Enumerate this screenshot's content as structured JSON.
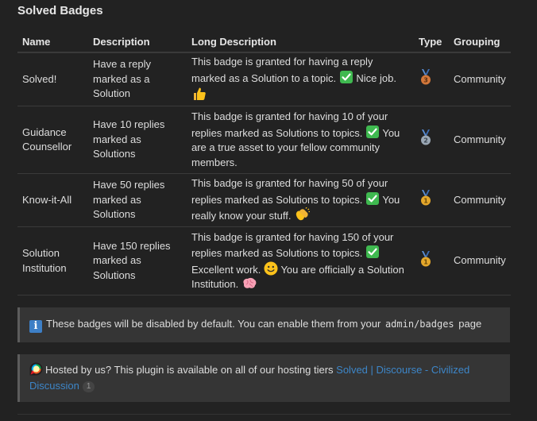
{
  "title": "Solved Badges",
  "columns": [
    "Name",
    "Description",
    "Long Description",
    "Type",
    "Grouping"
  ],
  "rows": [
    {
      "name": "Solved!",
      "description": "Have a reply marked as a Solution",
      "long_parts": [
        "This badge is granted for having a reply marked as a Solution to a topic.",
        "Nice job."
      ],
      "emojis": [
        "check-mark-emoji",
        "thumbs-up-emoji"
      ],
      "type": "bronze",
      "type_number": "3",
      "grouping": "Community"
    },
    {
      "name": "Guidance Counsellor",
      "description": "Have 10 replies marked as Solutions",
      "long_parts": [
        "This badge is granted for having 10 of your replies marked as Solutions to topics.",
        "You are a true asset to your fellow community members."
      ],
      "emojis": [
        "check-mark-emoji"
      ],
      "type": "silver",
      "type_number": "2",
      "grouping": "Community"
    },
    {
      "name": "Know-it-All",
      "description": "Have 50 replies marked as Solutions",
      "long_parts": [
        "This badge is granted for having 50 of your replies marked as Solutions to topics.",
        "You really know your stuff."
      ],
      "emojis": [
        "check-mark-emoji",
        "clapping-hands-emoji"
      ],
      "type": "gold",
      "type_number": "1",
      "grouping": "Community"
    },
    {
      "name": "Solution Institution",
      "description": "Have 150 replies marked as Solutions",
      "long_parts": [
        "This badge is granted for having 150 of your replies marked as Solutions to topics.",
        "Excellent work.",
        "You are officially a Solution Institution."
      ],
      "emojis": [
        "check-mark-emoji",
        "slightly-smiling-emoji",
        "brain-emoji"
      ],
      "type": "gold",
      "type_number": "1",
      "grouping": "Community"
    }
  ],
  "info_callout": {
    "icon": "i",
    "text": "These badges will be disabled by default. You can enable them from your",
    "code": "admin/badges",
    "text_after": "page"
  },
  "hosted_callout": {
    "text": "Hosted by us? This plugin is available on all of our hosting tiers",
    "link_text": "Solved | Discourse - Civilized Discussion",
    "link_count": "1"
  },
  "colors": {
    "background": "#222222",
    "callout_bg": "#353535",
    "link": "#3d86c8",
    "check_green": "#3fb950",
    "bronze": "#d2773a",
    "silver": "#9aa7b4",
    "gold": "#e4a72b",
    "ribbon": "#5b8fd6"
  }
}
